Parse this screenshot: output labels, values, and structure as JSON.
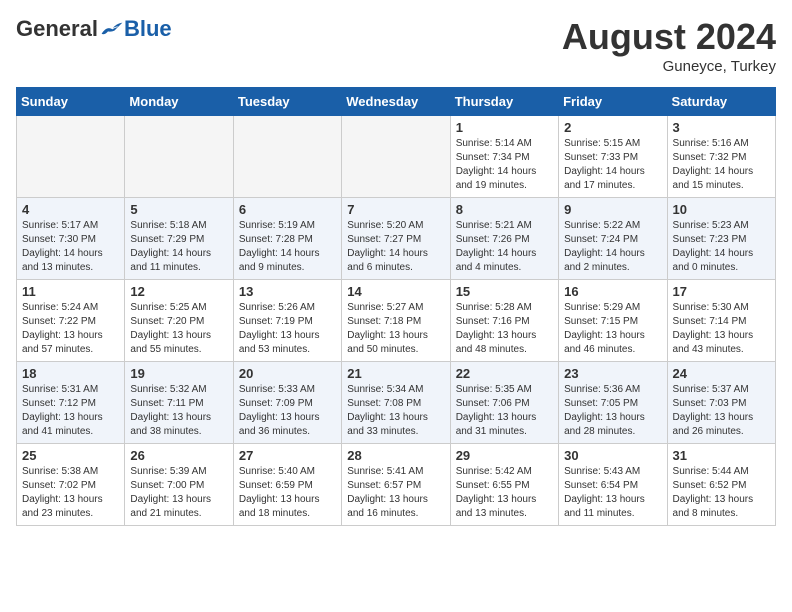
{
  "header": {
    "logo_general": "General",
    "logo_blue": "Blue",
    "month": "August 2024",
    "location": "Guneyce, Turkey"
  },
  "days_of_week": [
    "Sunday",
    "Monday",
    "Tuesday",
    "Wednesday",
    "Thursday",
    "Friday",
    "Saturday"
  ],
  "weeks": [
    [
      {
        "day": "",
        "info": ""
      },
      {
        "day": "",
        "info": ""
      },
      {
        "day": "",
        "info": ""
      },
      {
        "day": "",
        "info": ""
      },
      {
        "day": "1",
        "info": "Sunrise: 5:14 AM\nSunset: 7:34 PM\nDaylight: 14 hours\nand 19 minutes."
      },
      {
        "day": "2",
        "info": "Sunrise: 5:15 AM\nSunset: 7:33 PM\nDaylight: 14 hours\nand 17 minutes."
      },
      {
        "day": "3",
        "info": "Sunrise: 5:16 AM\nSunset: 7:32 PM\nDaylight: 14 hours\nand 15 minutes."
      }
    ],
    [
      {
        "day": "4",
        "info": "Sunrise: 5:17 AM\nSunset: 7:30 PM\nDaylight: 14 hours\nand 13 minutes."
      },
      {
        "day": "5",
        "info": "Sunrise: 5:18 AM\nSunset: 7:29 PM\nDaylight: 14 hours\nand 11 minutes."
      },
      {
        "day": "6",
        "info": "Sunrise: 5:19 AM\nSunset: 7:28 PM\nDaylight: 14 hours\nand 9 minutes."
      },
      {
        "day": "7",
        "info": "Sunrise: 5:20 AM\nSunset: 7:27 PM\nDaylight: 14 hours\nand 6 minutes."
      },
      {
        "day": "8",
        "info": "Sunrise: 5:21 AM\nSunset: 7:26 PM\nDaylight: 14 hours\nand 4 minutes."
      },
      {
        "day": "9",
        "info": "Sunrise: 5:22 AM\nSunset: 7:24 PM\nDaylight: 14 hours\nand 2 minutes."
      },
      {
        "day": "10",
        "info": "Sunrise: 5:23 AM\nSunset: 7:23 PM\nDaylight: 14 hours\nand 0 minutes."
      }
    ],
    [
      {
        "day": "11",
        "info": "Sunrise: 5:24 AM\nSunset: 7:22 PM\nDaylight: 13 hours\nand 57 minutes."
      },
      {
        "day": "12",
        "info": "Sunrise: 5:25 AM\nSunset: 7:20 PM\nDaylight: 13 hours\nand 55 minutes."
      },
      {
        "day": "13",
        "info": "Sunrise: 5:26 AM\nSunset: 7:19 PM\nDaylight: 13 hours\nand 53 minutes."
      },
      {
        "day": "14",
        "info": "Sunrise: 5:27 AM\nSunset: 7:18 PM\nDaylight: 13 hours\nand 50 minutes."
      },
      {
        "day": "15",
        "info": "Sunrise: 5:28 AM\nSunset: 7:16 PM\nDaylight: 13 hours\nand 48 minutes."
      },
      {
        "day": "16",
        "info": "Sunrise: 5:29 AM\nSunset: 7:15 PM\nDaylight: 13 hours\nand 46 minutes."
      },
      {
        "day": "17",
        "info": "Sunrise: 5:30 AM\nSunset: 7:14 PM\nDaylight: 13 hours\nand 43 minutes."
      }
    ],
    [
      {
        "day": "18",
        "info": "Sunrise: 5:31 AM\nSunset: 7:12 PM\nDaylight: 13 hours\nand 41 minutes."
      },
      {
        "day": "19",
        "info": "Sunrise: 5:32 AM\nSunset: 7:11 PM\nDaylight: 13 hours\nand 38 minutes."
      },
      {
        "day": "20",
        "info": "Sunrise: 5:33 AM\nSunset: 7:09 PM\nDaylight: 13 hours\nand 36 minutes."
      },
      {
        "day": "21",
        "info": "Sunrise: 5:34 AM\nSunset: 7:08 PM\nDaylight: 13 hours\nand 33 minutes."
      },
      {
        "day": "22",
        "info": "Sunrise: 5:35 AM\nSunset: 7:06 PM\nDaylight: 13 hours\nand 31 minutes."
      },
      {
        "day": "23",
        "info": "Sunrise: 5:36 AM\nSunset: 7:05 PM\nDaylight: 13 hours\nand 28 minutes."
      },
      {
        "day": "24",
        "info": "Sunrise: 5:37 AM\nSunset: 7:03 PM\nDaylight: 13 hours\nand 26 minutes."
      }
    ],
    [
      {
        "day": "25",
        "info": "Sunrise: 5:38 AM\nSunset: 7:02 PM\nDaylight: 13 hours\nand 23 minutes."
      },
      {
        "day": "26",
        "info": "Sunrise: 5:39 AM\nSunset: 7:00 PM\nDaylight: 13 hours\nand 21 minutes."
      },
      {
        "day": "27",
        "info": "Sunrise: 5:40 AM\nSunset: 6:59 PM\nDaylight: 13 hours\nand 18 minutes."
      },
      {
        "day": "28",
        "info": "Sunrise: 5:41 AM\nSunset: 6:57 PM\nDaylight: 13 hours\nand 16 minutes."
      },
      {
        "day": "29",
        "info": "Sunrise: 5:42 AM\nSunset: 6:55 PM\nDaylight: 13 hours\nand 13 minutes."
      },
      {
        "day": "30",
        "info": "Sunrise: 5:43 AM\nSunset: 6:54 PM\nDaylight: 13 hours\nand 11 minutes."
      },
      {
        "day": "31",
        "info": "Sunrise: 5:44 AM\nSunset: 6:52 PM\nDaylight: 13 hours\nand 8 minutes."
      }
    ]
  ]
}
